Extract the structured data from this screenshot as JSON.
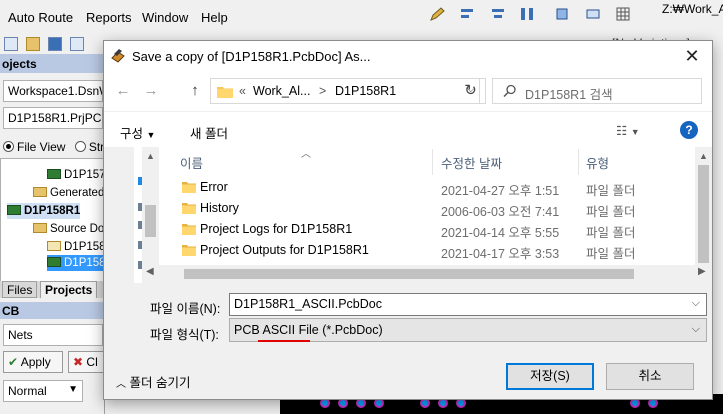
{
  "app": {
    "menus": [
      "Auto Route",
      "Reports",
      "Window",
      "Help"
    ],
    "path_label": "Z:₩Work_A",
    "no_variations": "[No Variations]"
  },
  "left_panel": {
    "header": "ojects",
    "workspace": "Workspace1.DsnW",
    "project": "D1P158R1.PrjPCB",
    "file_view": "File View",
    "structure_partial": "Str",
    "tree": [
      "D1P157",
      "Generated",
      "D1P158R1",
      "Source Do",
      "D1P158",
      "D1P158"
    ],
    "tabs": [
      "Files",
      "Projects"
    ],
    "pcb_header": "CB",
    "nets_field": "Nets",
    "apply_label": "Apply",
    "clear_partial": "Cl",
    "normal_label": "Normal"
  },
  "dialog": {
    "title": "Save a copy of [D1P158R1.PcbDoc] As...",
    "address": {
      "prefix": "«",
      "crumb1": "Work_Al...",
      "sep": ">",
      "crumb2": "D1P158R1"
    },
    "search_placeholder": "D1P158R1 검색",
    "organize_label": "구성",
    "new_folder_label": "새 폴더",
    "columns": {
      "name": "이름",
      "date": "수정한 날짜",
      "type": "유형"
    },
    "files": [
      {
        "name": "Error",
        "date": "2021-04-27 오후 1:51",
        "type": "파일 폴더"
      },
      {
        "name": "History",
        "date": "2006-06-03 오전 7:41",
        "type": "파일 폴더"
      },
      {
        "name": "Project Logs for D1P158R1",
        "date": "2021-04-14 오후 5:55",
        "type": "파일 폴더"
      },
      {
        "name": "Project Outputs for D1P158R1",
        "date": "2021-04-17 오후 3:53",
        "type": "파일 폴더"
      }
    ],
    "filename_label": "파일 이름(N):",
    "filename_value": "D1P158R1_ASCII.PcbDoc",
    "filetype_label": "파일 형식(T):",
    "filetype_value": "PCB ASCII File (*.PcbDoc)",
    "hide_folders": "폴더 숨기기",
    "save_button": "저장(S)",
    "cancel_button": "취소"
  },
  "colors": {
    "accent": "#0078d7",
    "highlight": "#3399ff",
    "annotation_red": "#e00000",
    "folder": "#f5c65a"
  }
}
